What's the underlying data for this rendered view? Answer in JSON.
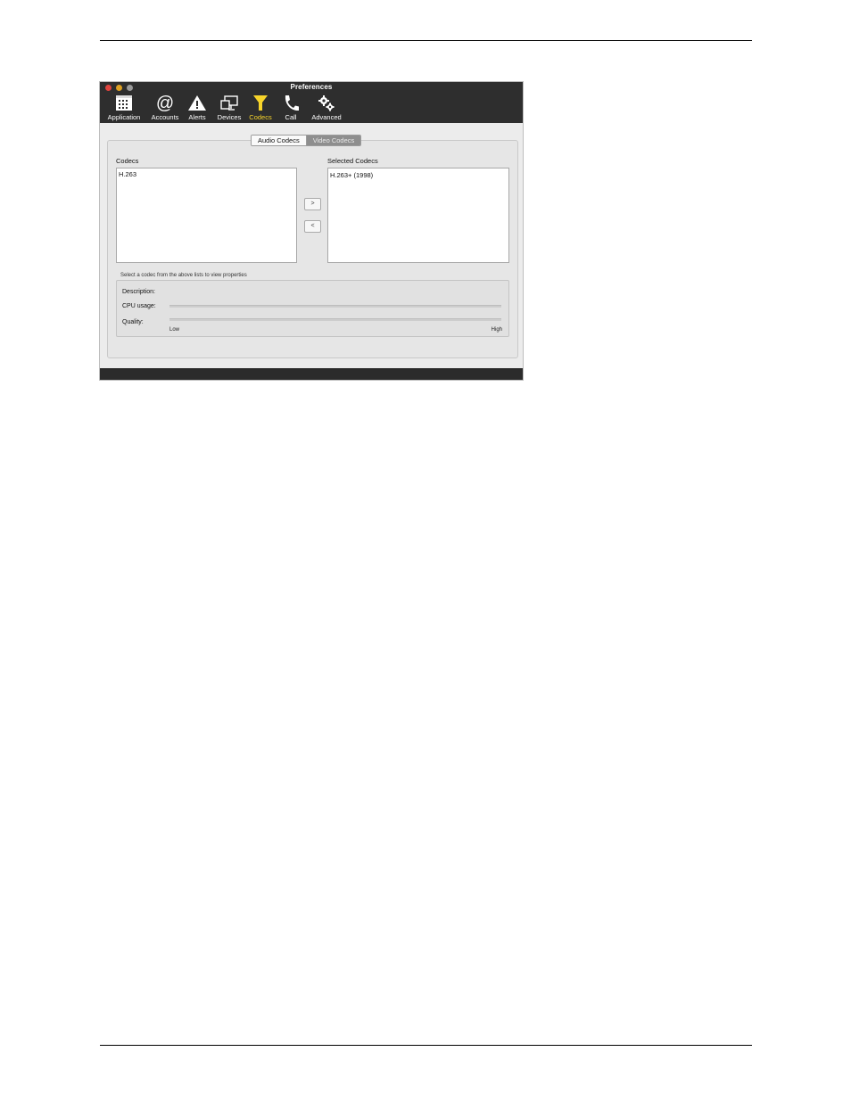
{
  "window": {
    "title": "Preferences"
  },
  "toolbar": {
    "items": [
      {
        "label": "Application",
        "icon": "application-grid-icon",
        "active": false
      },
      {
        "label": "Accounts",
        "icon": "at-sign-icon",
        "active": false
      },
      {
        "label": "Alerts",
        "icon": "warning-triangle-icon",
        "active": false
      },
      {
        "label": "Devices",
        "icon": "monitor-devices-icon",
        "active": false
      },
      {
        "label": "Codecs",
        "icon": "funnel-icon",
        "active": true
      },
      {
        "label": "Call",
        "icon": "phone-handset-icon",
        "active": false
      },
      {
        "label": "Advanced",
        "icon": "gears-icon",
        "active": false
      }
    ]
  },
  "tabs": {
    "audio": "Audio Codecs",
    "video": "Video Codecs",
    "selected": "video"
  },
  "codecs": {
    "label": "Codecs",
    "items": [
      "H.263"
    ]
  },
  "selected_codecs": {
    "label": "Selected Codecs",
    "items": [
      "H.263+ (1998)"
    ]
  },
  "buttons": {
    "add": ">",
    "remove": "<"
  },
  "properties": {
    "hint": "Select a codec from the above lists to view properties",
    "description_label": "Description:",
    "cpu_label": "CPU usage:",
    "quality_label": "Quality:",
    "low": "Low",
    "high": "High"
  },
  "colors": {
    "toolbar_bg": "#2e2e2e",
    "active_accent": "#f7d42a"
  }
}
